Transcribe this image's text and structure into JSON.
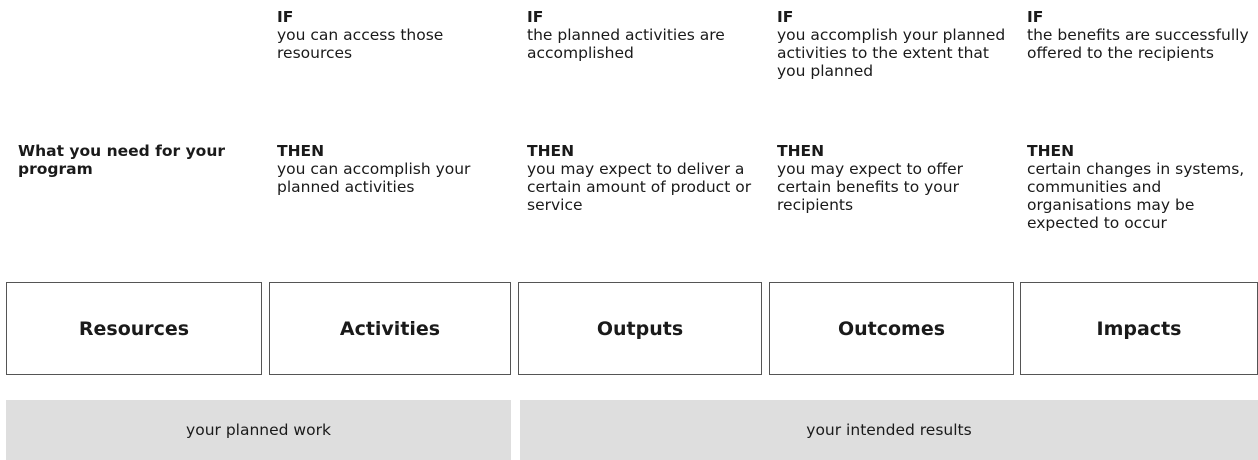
{
  "needs_label": "What you need for your program",
  "columns": [
    {
      "if_keyword": "IF",
      "if_text": "you can access those resources",
      "then_keyword": "THEN",
      "then_text": "you can accomplish your planned activities"
    },
    {
      "if_keyword": "IF",
      "if_text": "the planned activities are accomplished",
      "then_keyword": "THEN",
      "then_text": "you may expect to deliver a certain amount of product or service"
    },
    {
      "if_keyword": "IF",
      "if_text": "you accomplish your planned activities to the extent that you planned",
      "then_keyword": "THEN",
      "then_text": "you may expect to offer certain benefits to your recipients"
    },
    {
      "if_keyword": "IF",
      "if_text": "the benefits are successfully offered to the recipients",
      "then_keyword": "THEN",
      "then_text": "certain changes in systems, communities and organisations may be expected to occur"
    }
  ],
  "stages": [
    "Resources",
    "Activities",
    "Outputs",
    "Outcomes",
    "Impacts"
  ],
  "groups": {
    "planned_work": "your planned work",
    "intended_results": "your intended results"
  }
}
